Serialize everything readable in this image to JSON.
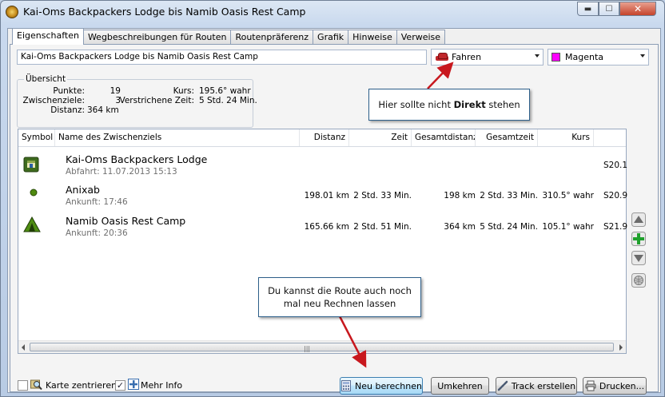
{
  "window": {
    "title": "Kai-Oms Backpackers Lodge bis Namib Oasis Rest Camp",
    "min_symbol": "▬",
    "max_symbol": "☐",
    "close_symbol": "✕"
  },
  "tabs": [
    {
      "label": "Eigenschaften",
      "active": true
    },
    {
      "label": "Wegbeschreibungen für Routen"
    },
    {
      "label": "Routenpräferenz"
    },
    {
      "label": "Grafik"
    },
    {
      "label": "Hinweise"
    },
    {
      "label": "Verweise"
    }
  ],
  "route_name": "Kai-Oms Backpackers Lodge bis Namib Oasis Rest Camp",
  "mode_combo": {
    "value": "Fahren",
    "icon": "car-icon"
  },
  "color_combo": {
    "value": "Magenta",
    "swatch": "#ff00ff"
  },
  "overview": {
    "title": "Übersicht",
    "points_label": "Punkte:",
    "points_value": "19",
    "vias_label": "Zwischenziele:",
    "vias_value": "3",
    "distance_label": "Distanz:",
    "distance_value": "364 km",
    "course_label": "Kurs:",
    "course_value": "195.6° wahr",
    "elapsed_label": "Verstrichene Zeit:",
    "elapsed_value": "5 Std. 24 Min."
  },
  "columns": {
    "symbol": "Symbol",
    "name": "Name des Zwischenziels",
    "distance": "Distanz",
    "time": "Zeit",
    "total_distance": "Gesamtdistanz",
    "total_time": "Gesamtzeit",
    "course": "Kurs"
  },
  "waypoints": [
    {
      "name": "Kai-Oms Backpackers Lodge",
      "sub": "Abfahrt: 11.07.2013 15:13",
      "distance": "",
      "time": "",
      "total_distance": "",
      "total_time": "",
      "course": "",
      "pos": "S20.1",
      "icon": "lodge-icon"
    },
    {
      "name": "Anixab",
      "sub": "Ankunft: 17:46",
      "distance": "198.01 km",
      "time": "2 Std. 33 Min.",
      "total_distance": "198 km",
      "total_time": "2 Std. 33 Min.",
      "course": "310.5° wahr",
      "pos": "S20.9",
      "icon": "dot-icon"
    },
    {
      "name": "Namib Oasis Rest Camp",
      "sub": "Ankunft: 20:36",
      "distance": "165.66 km",
      "time": "2 Std. 51 Min.",
      "total_distance": "364 km",
      "total_time": "5 Std. 24 Min.",
      "course": "105.1° wahr",
      "pos": "S21.9",
      "icon": "tent-icon"
    }
  ],
  "scrollbar": {
    "grip": "|||"
  },
  "bottom": {
    "center_map_label": "Karte zentrieren",
    "more_info_label": "Mehr Info",
    "more_info_check": "✓",
    "recalc_label": "Neu berechnen",
    "reverse_label": "Umkehren",
    "track_label": "Track erstellen",
    "print_label": "Drucken..."
  },
  "callouts": {
    "direct_prefix": "Hier sollte nicht ",
    "direct_bold": "Direkt",
    "direct_suffix": " stehen",
    "recalc_line1": "Du kannst die Route auch noch",
    "recalc_line2": "mal neu Rechnen lassen"
  },
  "colors": {
    "accent": "#c0262a",
    "callout_border": "#2d5f8a",
    "magenta": "#ff00ff"
  }
}
